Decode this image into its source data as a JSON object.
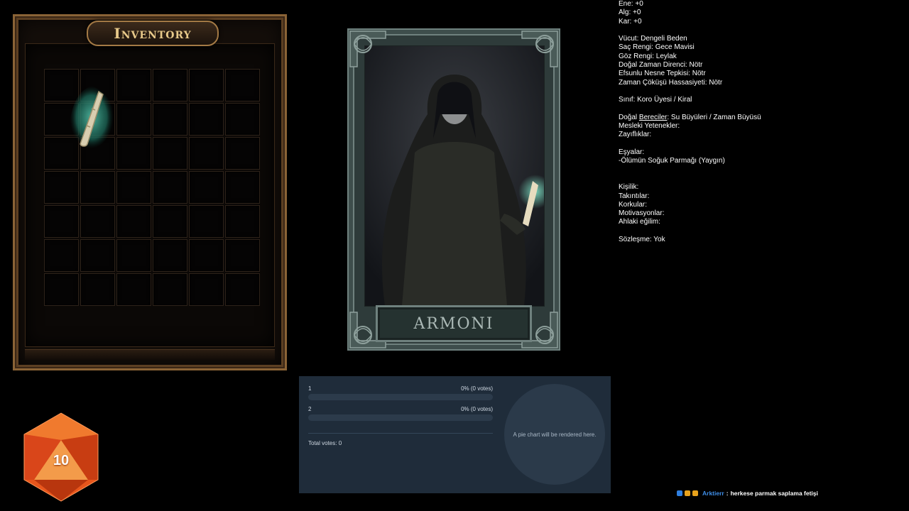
{
  "inventory": {
    "title": "Inventory",
    "rows": 7,
    "cols": 6,
    "items": [
      {
        "name": "Ölümün Soğuk Parmağı",
        "icon": "bone-finger-icon"
      }
    ]
  },
  "character": {
    "name": "ARMONI"
  },
  "stats": {
    "lines": [
      "Ene: +0",
      "Alg: +0",
      "Kar: +0",
      "",
      "Vücut: Dengeli Beden",
      "Saç Rengi: Gece Mavisi",
      "Göz Rengi: Leylak",
      "Doğal Zaman Direnci: Nötr",
      "Efsunlu Nesne Tepkisi: Nötr",
      "Zaman Çöküşü Hassasiyeti: Nötr",
      "",
      "Sınıf: Koro Üyesi / Kiral",
      "",
      "Doğal Bereciler: Su Büyüleri / Zaman Büyüsü",
      "Mesleki Yetenekler:",
      "Zayıflıklar:",
      "",
      "Eşyalar:",
      "-Ölümün Soğuk Parmağı (Yaygın)",
      "",
      "",
      "Kişilik:",
      "Takıntılar:",
      "Korkular:",
      "Motivasyonlar:",
      "Ahlaki eğilim:",
      "",
      "Sözleşme: Yok"
    ]
  },
  "poll": {
    "options": [
      {
        "label": "1",
        "percent_text": "0% (0 votes)",
        "fraction": 0
      },
      {
        "label": "2",
        "percent_text": "0% (0 votes)",
        "fraction": 0
      }
    ],
    "total": "Total votes: 0",
    "pie_placeholder": "A pie chart will be rendered here."
  },
  "dice": {
    "value": "10",
    "color": "#e8561c"
  },
  "chat": {
    "user": "Arktierr",
    "separator": ":",
    "message": "herkese parmak saplama fetişi",
    "badges": [
      "#2f7fe0",
      "#e8a21c",
      "#e8a21c"
    ]
  }
}
